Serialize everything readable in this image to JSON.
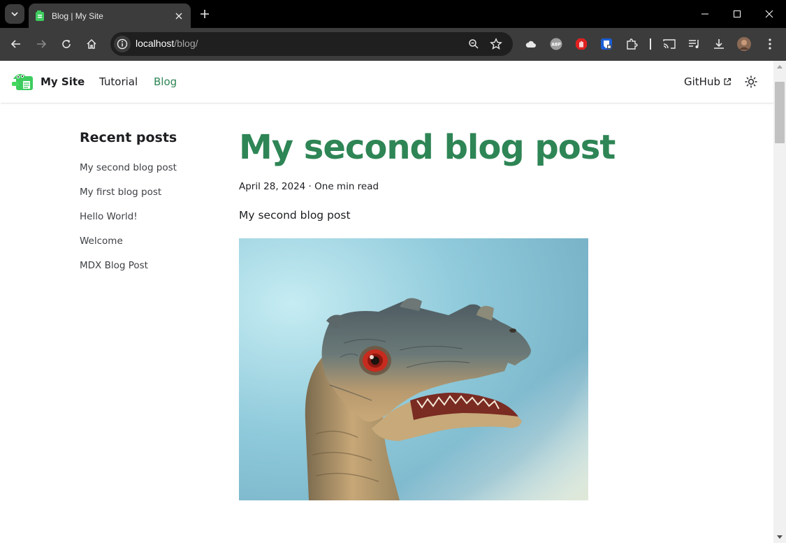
{
  "browser": {
    "tab_title": "Blog | My Site",
    "url_host": "localhost",
    "url_path": "/blog/"
  },
  "site": {
    "brand": "My Site",
    "nav": [
      "Tutorial",
      "Blog"
    ],
    "github_label": "GitHub",
    "accent_color": "#2e8555"
  },
  "sidebar": {
    "title": "Recent posts",
    "items": [
      "My second blog post",
      "My first blog post",
      "Hello World!",
      "Welcome",
      "MDX Blog Post"
    ]
  },
  "post": {
    "title": "My second blog post",
    "meta": "April 28, 2024 · One min read",
    "body": "My second blog post",
    "image_alt": "dinosaur-toy-photo"
  }
}
